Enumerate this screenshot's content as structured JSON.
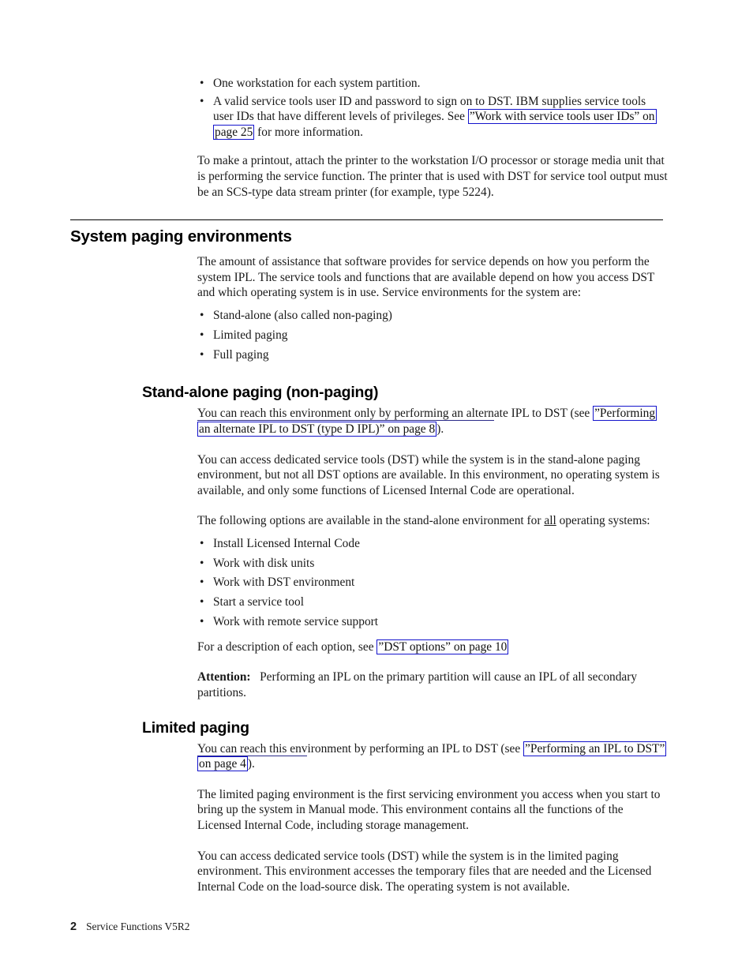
{
  "document": {
    "running_title": "Service Functions V5R2",
    "page_number": "2",
    "link_color": "#1414cc"
  },
  "intro": {
    "bullets": [
      "One workstation for each system partition.",
      {
        "pre": "A valid service tools user ID and password to sign on to DST. IBM supplies service tools user IDs that have different levels of privileges. See ",
        "link": "”Work with service tools user IDs” on page 25",
        "post": " for more information."
      }
    ],
    "paragraph": "To make a printout, attach the printer to the workstation I/O processor or storage media unit that is performing the service function. The printer that is used with DST for service tool output must be an SCS-type data stream printer (for example, type 5224)."
  },
  "section_system_paging": {
    "heading": "System paging environments",
    "paragraph": "The amount of assistance that software provides for service depends on how you perform the system IPL. The service tools and functions that are available depend on how you access DST and which operating system is in use. Service environments for the system are:",
    "bullets": [
      "Stand-alone (also called non-paging)",
      "Limited paging",
      "Full paging"
    ]
  },
  "section_standalone": {
    "heading": "Stand-alone paging (non-paging)",
    "intro_pre": "You can reach this environment only by performing an altern",
    "intro_mid": "ate IPL to DST (see ",
    "intro_link": "”Performing an alternate IPL to DST (type D IPL)” on page 8",
    "intro_post": ").",
    "paragraph_2": "You can access dedicated service tools (DST) while the system is in the stand-alone paging environment, but not all DST options are available. In this environment, no operating system is available, and only some functions of Licensed Internal Code are operational.",
    "paragraph_3_pre": "The following options are available in the stand-alone environment for ",
    "paragraph_3_emph": "all",
    "paragraph_3_post": " operating systems:",
    "options": [
      "Install Licensed Internal Code",
      "Work with disk units",
      "Work with DST environment",
      "Start a service tool",
      "Work with remote service support"
    ],
    "description_pre": "For a description of each option, see ",
    "description_link": "”DST options” on page 10",
    "attention_label": "Attention:",
    "attention_text": "Performing an IPL on the primary partition will cause an IPL of all secondary partitions."
  },
  "section_limited": {
    "heading": "Limited paging",
    "intro_pre": "You can reach this env",
    "intro_mid": "ironment by performing an IPL to DST (see ",
    "intro_link": "”Performing an IPL to DST” on page 4",
    "intro_post": ").",
    "paragraph_2": "The limited paging environment is the first servicing environment you access when you start to bring up the system in Manual mode. This environment contains all the functions of the Licensed Internal Code, including storage management.",
    "paragraph_3": "You can access dedicated service tools (DST) while the system is in the limited paging environment. This environment accesses the temporary files that are needed and the Licensed Internal Code on the load-source disk. The operating system is not available."
  }
}
